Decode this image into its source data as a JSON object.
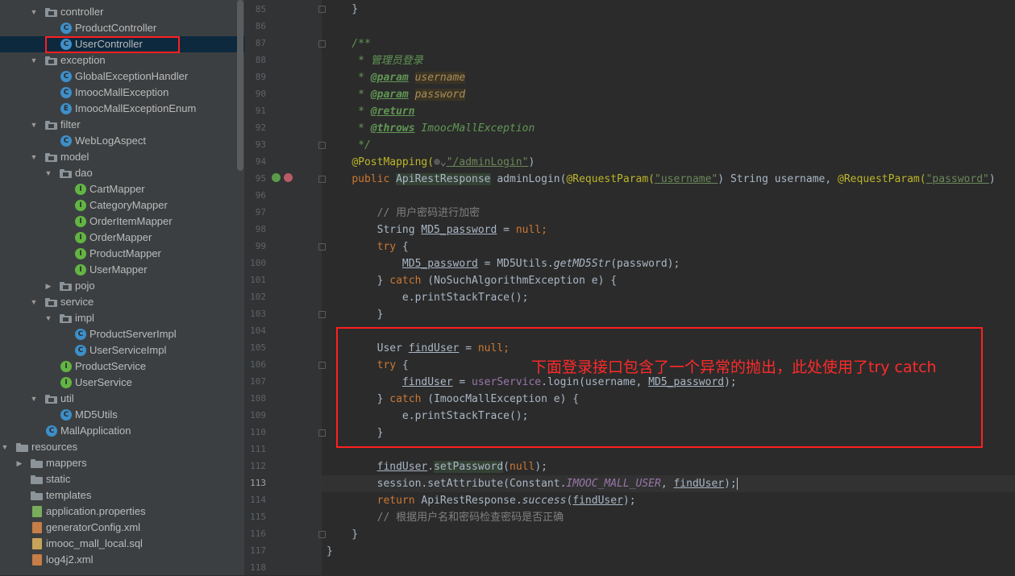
{
  "project_tree": [
    {
      "label": "controller",
      "depth": 3,
      "kind": "package",
      "expanded": true
    },
    {
      "label": "ProductController",
      "depth": 4,
      "kind": "class"
    },
    {
      "label": "UserController",
      "depth": 4,
      "kind": "class",
      "selected": true
    },
    {
      "label": "exception",
      "depth": 3,
      "kind": "package",
      "expanded": true
    },
    {
      "label": "GlobalExceptionHandler",
      "depth": 4,
      "kind": "class"
    },
    {
      "label": "ImoocMallException",
      "depth": 4,
      "kind": "class"
    },
    {
      "label": "ImoocMallExceptionEnum",
      "depth": 4,
      "kind": "enum"
    },
    {
      "label": "filter",
      "depth": 3,
      "kind": "package",
      "expanded": true
    },
    {
      "label": "WebLogAspect",
      "depth": 4,
      "kind": "class"
    },
    {
      "label": "model",
      "depth": 3,
      "kind": "package",
      "expanded": true
    },
    {
      "label": "dao",
      "depth": 4,
      "kind": "package",
      "expanded": true
    },
    {
      "label": "CartMapper",
      "depth": 5,
      "kind": "interface"
    },
    {
      "label": "CategoryMapper",
      "depth": 5,
      "kind": "interface"
    },
    {
      "label": "OrderItemMapper",
      "depth": 5,
      "kind": "interface"
    },
    {
      "label": "OrderMapper",
      "depth": 5,
      "kind": "interface"
    },
    {
      "label": "ProductMapper",
      "depth": 5,
      "kind": "interface"
    },
    {
      "label": "UserMapper",
      "depth": 5,
      "kind": "interface"
    },
    {
      "label": "pojo",
      "depth": 4,
      "kind": "package",
      "expanded": false
    },
    {
      "label": "service",
      "depth": 3,
      "kind": "package",
      "expanded": true
    },
    {
      "label": "impl",
      "depth": 4,
      "kind": "package",
      "expanded": true
    },
    {
      "label": "ProductServerImpl",
      "depth": 5,
      "kind": "class"
    },
    {
      "label": "UserServiceImpl",
      "depth": 5,
      "kind": "class"
    },
    {
      "label": "ProductService",
      "depth": 4,
      "kind": "interface"
    },
    {
      "label": "UserService",
      "depth": 4,
      "kind": "interface"
    },
    {
      "label": "util",
      "depth": 3,
      "kind": "package",
      "expanded": true
    },
    {
      "label": "MD5Utils",
      "depth": 4,
      "kind": "class"
    },
    {
      "label": "MallApplication",
      "depth": 3,
      "kind": "app"
    },
    {
      "label": "resources",
      "depth": 1,
      "kind": "resources",
      "expanded": true
    },
    {
      "label": "mappers",
      "depth": 2,
      "kind": "folder",
      "expanded": false
    },
    {
      "label": "static",
      "depth": 2,
      "kind": "folder"
    },
    {
      "label": "templates",
      "depth": 2,
      "kind": "folder"
    },
    {
      "label": "application.properties",
      "depth": 2,
      "kind": "props"
    },
    {
      "label": "generatorConfig.xml",
      "depth": 2,
      "kind": "xml"
    },
    {
      "label": "imooc_mall_local.sql",
      "depth": 2,
      "kind": "sql"
    },
    {
      "label": "log4j2.xml",
      "depth": 2,
      "kind": "xml"
    }
  ],
  "line_numbers": [
    "85",
    "86",
    "87",
    "88",
    "89",
    "90",
    "91",
    "92",
    "93",
    "94",
    "95",
    "96",
    "97",
    "98",
    "99",
    "100",
    "101",
    "102",
    "103",
    "104",
    "105",
    "106",
    "107",
    "108",
    "109",
    "110",
    "111",
    "112",
    "113",
    "114",
    "115",
    "116",
    "117",
    "118"
  ],
  "current_line": "113",
  "code": {
    "doc_open": "/**",
    "doc_title": " * 管理员登录",
    "param_tag": "@param",
    "param_username": "username",
    "param_password": "password",
    "return_tag": "@return",
    "throws_tag": "@throws",
    "throws_type": "ImoocMallException",
    "doc_close": " */",
    "post_mapping": "@PostMapping(",
    "post_mapping_path": "\"/adminLogin\"",
    "method_sig_public": "public ",
    "method_sig_type": "ApiRestResponse",
    "method_sig_name": " adminLogin(",
    "request_param": "@RequestParam(",
    "username_str": "\"username\"",
    "string_username": ") String username, ",
    "password_str": "\"password\"",
    "comment_encrypt": "// 用户密码进行加密",
    "comment_check": "// 根据用户名和密码检查密码是否正确"
  },
  "annotation_note": "下面登录接口包含了一个异常的抛出，此处使用了try catch",
  "colors": {
    "highlight_box": "#ff1f1f",
    "note_text": "#ff2a2a"
  }
}
